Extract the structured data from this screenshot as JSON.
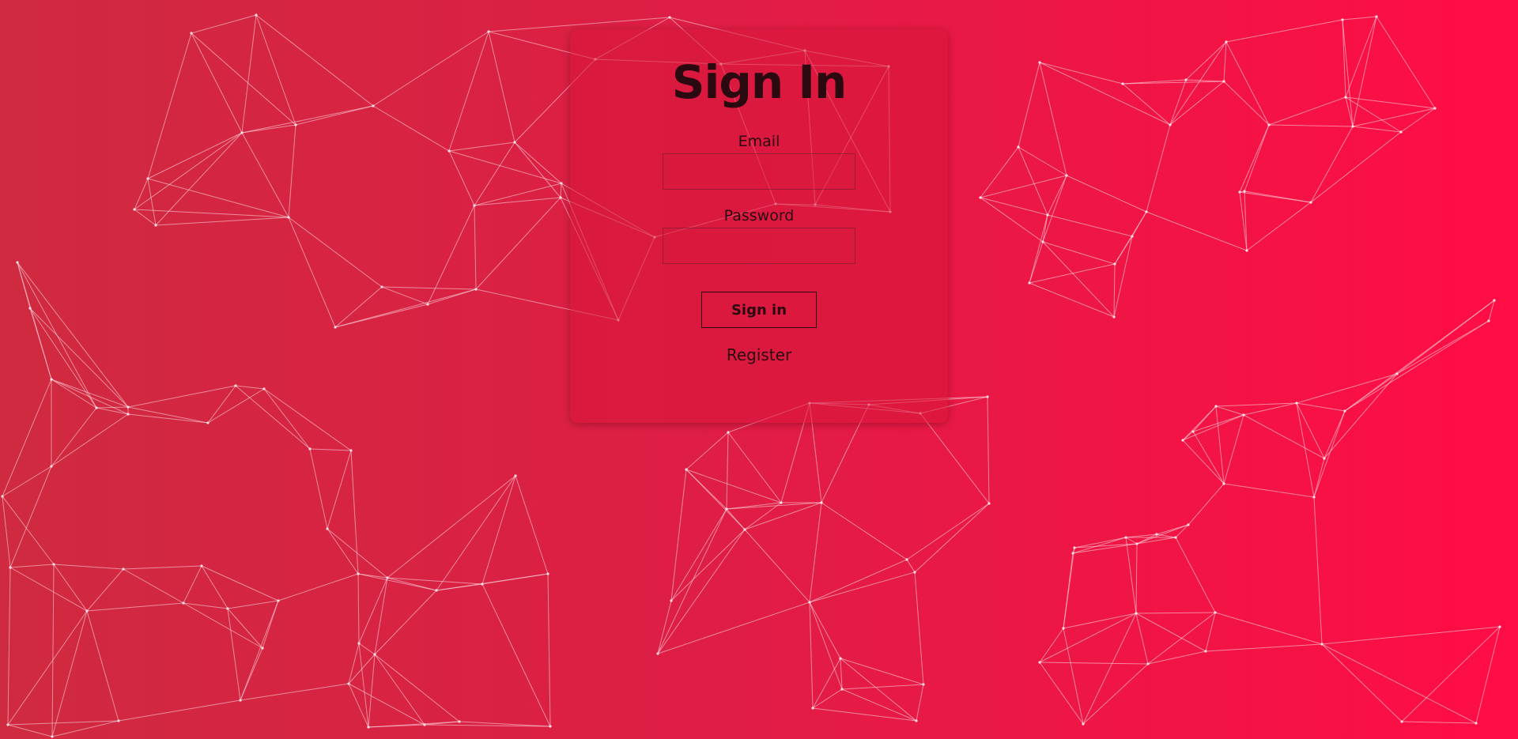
{
  "background": {
    "gradient_start": "#cf2a40",
    "gradient_end": "#ff0d45",
    "network_color": "#ffe1e8"
  },
  "signin": {
    "title": "Sign In",
    "email_label": "Email",
    "email_value": "",
    "password_label": "Password",
    "password_value": "",
    "button_label": "Sign in",
    "register_label": "Register"
  }
}
